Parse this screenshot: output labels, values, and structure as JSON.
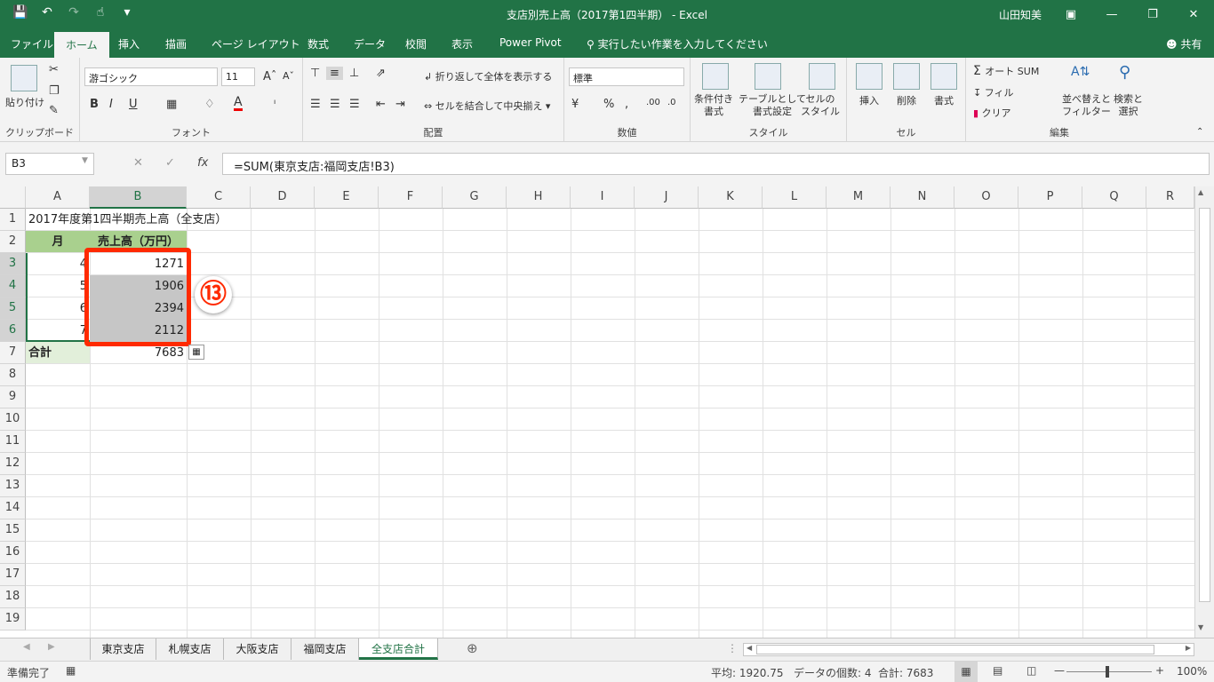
{
  "app": {
    "title": "支店別売上高（2017第1四半期） - Excel",
    "user": "山田知美",
    "share_label": "共有",
    "tell_me": "実行したい作業を入力してください"
  },
  "menu_tabs": [
    "ファイル",
    "ホーム",
    "挿入",
    "描画",
    "ページ レイアウト",
    "数式",
    "データ",
    "校閲",
    "表示",
    "Power Pivot"
  ],
  "ribbon": {
    "clipboard": {
      "paste": "貼り付け",
      "label": "クリップボード"
    },
    "font": {
      "name": "游ゴシック",
      "size": "11",
      "label": "フォント"
    },
    "alignment": {
      "wrap": "折り返して全体を表示する",
      "merge": "セルを結合して中央揃え",
      "label": "配置"
    },
    "number": {
      "format": "標準",
      "label": "数値"
    },
    "styles": {
      "cond": [
        "条件付き",
        "書式"
      ],
      "table": [
        "テーブルとして",
        "書式設定"
      ],
      "cell": [
        "セルの",
        "スタイル"
      ],
      "label": "スタイル"
    },
    "cells": {
      "insert": "挿入",
      "delete": "削除",
      "format": "書式",
      "label": "セル"
    },
    "editing": {
      "autosum": "オート SUM",
      "fill": "フィル",
      "clear": "クリア",
      "sort": [
        "並べ替えと",
        "フィルター"
      ],
      "find": [
        "検索と",
        "選択"
      ],
      "label": "編集"
    }
  },
  "formula_bar": {
    "name_box": "B3",
    "formula": "=SUM(東京支店:福岡支店!B3)"
  },
  "columns": [
    "A",
    "B",
    "C",
    "D",
    "E",
    "F",
    "G",
    "H",
    "I",
    "J",
    "K",
    "L",
    "M",
    "N",
    "O",
    "P",
    "Q",
    "R"
  ],
  "rows": [
    "1",
    "2",
    "3",
    "4",
    "5",
    "6",
    "7",
    "8",
    "9",
    "10",
    "11",
    "12",
    "13",
    "14",
    "15",
    "16",
    "17",
    "18",
    "19"
  ],
  "cells": {
    "a1": "2017年度第1四半期売上高（全支店）",
    "a2": "月",
    "b2": "売上高（万円）",
    "a3": "4",
    "a4": "5",
    "a5": "6",
    "a6": "7",
    "b3": "1271",
    "b4": "1906",
    "b5": "2394",
    "b6": "2112",
    "a7": "合計",
    "b7": "7683"
  },
  "callout": "⑬",
  "sheets": [
    "東京支店",
    "札幌支店",
    "大阪支店",
    "福岡支店",
    "全支店合計"
  ],
  "status": {
    "ready": "準備完了",
    "average": "平均: 1920.75",
    "count": "データの個数: 4",
    "sum": "合計: 7683",
    "zoom": "100%"
  },
  "colors": {
    "accent": "#217346",
    "header_fill": "#a9d08e",
    "highlight": "#ff2a00"
  }
}
